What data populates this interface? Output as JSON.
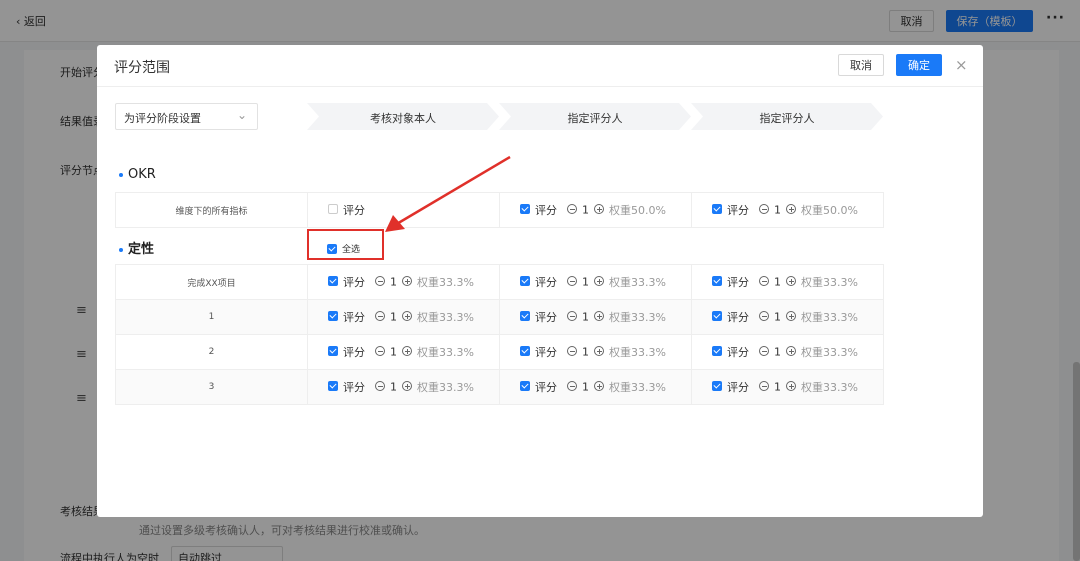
{
  "background": {
    "back_label": "返回",
    "cancel_label": "取消",
    "save_label": "保存（模板）",
    "more_label": "···",
    "labels": [
      "开始评分",
      "结果值录",
      "评分节点",
      "考核结果"
    ],
    "hint": "通过设置多级考核确认人，可对考核结果进行校准或确认。",
    "bottom_label": "流程中执行人为空时",
    "bottom_select": "自动跳过",
    "menu_icon": "≡"
  },
  "modal": {
    "title": "评分范围",
    "cancel_label": "取消",
    "confirm_label": "确定",
    "close_icon": "×"
  },
  "stage_select": {
    "value": "为评分阶段设置"
  },
  "stages": [
    "考核对象本人",
    "指定评分人",
    "指定评分人"
  ],
  "sections": {
    "okr": {
      "title": "OKR",
      "rows": [
        {
          "name": "维度下的所有指标",
          "cells": [
            {
              "checked": false,
              "label": "评分"
            },
            {
              "checked": true,
              "label": "评分",
              "count": "1",
              "weight": "权重50.0%"
            },
            {
              "checked": true,
              "label": "评分",
              "count": "1",
              "weight": "权重50.0%"
            }
          ]
        }
      ]
    },
    "qual": {
      "title": "定性",
      "select_all": "全选",
      "rows": [
        {
          "name": "完成XX项目",
          "cells": [
            {
              "checked": true,
              "label": "评分",
              "count": "1",
              "weight": "权重33.3%"
            },
            {
              "checked": true,
              "label": "评分",
              "count": "1",
              "weight": "权重33.3%"
            },
            {
              "checked": true,
              "label": "评分",
              "count": "1",
              "weight": "权重33.3%"
            }
          ]
        },
        {
          "name": "1",
          "cells": [
            {
              "checked": true,
              "label": "评分",
              "count": "1",
              "weight": "权重33.3%"
            },
            {
              "checked": true,
              "label": "评分",
              "count": "1",
              "weight": "权重33.3%"
            },
            {
              "checked": true,
              "label": "评分",
              "count": "1",
              "weight": "权重33.3%"
            }
          ]
        },
        {
          "name": "2",
          "cells": [
            {
              "checked": true,
              "label": "评分",
              "count": "1",
              "weight": "权重33.3%"
            },
            {
              "checked": true,
              "label": "评分",
              "count": "1",
              "weight": "权重33.3%"
            },
            {
              "checked": true,
              "label": "评分",
              "count": "1",
              "weight": "权重33.3%"
            }
          ]
        },
        {
          "name": "3",
          "cells": [
            {
              "checked": true,
              "label": "评分",
              "count": "1",
              "weight": "权重33.3%"
            },
            {
              "checked": true,
              "label": "评分",
              "count": "1",
              "weight": "权重33.3%"
            },
            {
              "checked": true,
              "label": "评分",
              "count": "1",
              "weight": "权重33.3%"
            }
          ]
        }
      ]
    }
  },
  "colors": {
    "accent": "#1a7af8",
    "highlight": "#e0302a"
  }
}
